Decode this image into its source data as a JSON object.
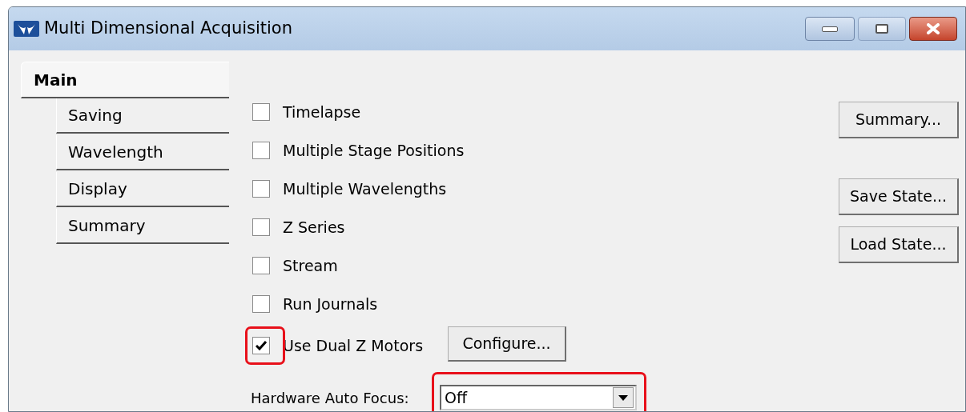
{
  "window": {
    "title": "Multi Dimensional Acquisition"
  },
  "tabs": [
    {
      "label": "Main",
      "selected": true
    },
    {
      "label": "Saving",
      "selected": false
    },
    {
      "label": "Wavelength",
      "selected": false
    },
    {
      "label": "Display",
      "selected": false
    },
    {
      "label": "Summary",
      "selected": false
    }
  ],
  "options": [
    {
      "label": "Timelapse",
      "checked": false,
      "highlighted": false
    },
    {
      "label": "Multiple Stage Positions",
      "checked": false,
      "highlighted": false
    },
    {
      "label": "Multiple Wavelengths",
      "checked": false,
      "highlighted": false
    },
    {
      "label": "Z Series",
      "checked": false,
      "highlighted": false
    },
    {
      "label": "Stream",
      "checked": false,
      "highlighted": false
    },
    {
      "label": "Run Journals",
      "checked": false,
      "highlighted": false
    },
    {
      "label": "Use Dual Z Motors",
      "checked": true,
      "highlighted": true,
      "button": "Configure..."
    }
  ],
  "auto_focus": {
    "label": "Hardware Auto Focus:",
    "value": "Off",
    "highlighted": true
  },
  "side_buttons": [
    "Summary...",
    "Save State...",
    "Load State..."
  ]
}
